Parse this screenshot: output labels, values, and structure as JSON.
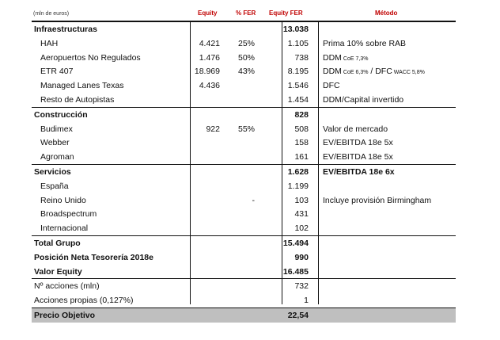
{
  "header": {
    "unit": "(mln de euros)",
    "equity": "Equity",
    "fer_pct": "% FER",
    "equity_fer": "Equity FER",
    "method": "Método"
  },
  "rows": [
    {
      "label": "Infraestructuras",
      "equity": "",
      "fer": "",
      "efer": "13.038",
      "method": "",
      "type": "section"
    },
    {
      "label": "HAH",
      "equity": "4.421",
      "fer": "25%",
      "efer": "1.105",
      "method": "Prima 10% sobre RAB",
      "type": "sub"
    },
    {
      "label": "Aeropuertos No Regulados",
      "equity": "1.476",
      "fer": "50%",
      "efer": "738",
      "method": "DDM",
      "method_small": "CoE 7,3%",
      "type": "sub"
    },
    {
      "label": "ETR 407",
      "equity": "18.969",
      "fer": "43%",
      "efer": "8.195",
      "method": "DDM",
      "method_small": "CoE 6,3%",
      "method2": " / DFC",
      "method_small2": "WACC 5,8%",
      "type": "sub"
    },
    {
      "label": "Managed Lanes Texas",
      "equity": "4.436",
      "fer": "",
      "efer": "1.546",
      "method": "DFC",
      "type": "sub"
    },
    {
      "label": "Resto de Autopistas",
      "equity": "",
      "fer": "",
      "efer": "1.454",
      "method": "DDM/Capital invertido",
      "type": "sub"
    },
    {
      "label": "Construcción",
      "equity": "",
      "fer": "",
      "efer": "828",
      "method": "",
      "type": "section"
    },
    {
      "label": "Budimex",
      "equity": "922",
      "fer": "55%",
      "efer": "508",
      "method": "Valor de mercado",
      "type": "sub"
    },
    {
      "label": "Webber",
      "equity": "",
      "fer": "",
      "efer": "158",
      "method": "EV/EBITDA 18e 5x",
      "type": "sub"
    },
    {
      "label": "Agroman",
      "equity": "",
      "fer": "",
      "efer": "161",
      "method": "EV/EBITDA 18e 5x",
      "type": "sub"
    },
    {
      "label": "Servicios",
      "equity": "",
      "fer": "",
      "efer": "1.628",
      "method": "EV/EBITDA 18e 6x",
      "type": "section"
    },
    {
      "label": "España",
      "equity": "",
      "fer": "",
      "efer": "1.199",
      "method": "",
      "type": "sub"
    },
    {
      "label": "Reino Unido",
      "equity": "",
      "fer": "-",
      "efer": "103",
      "method": "Incluye provisión Birmingham",
      "type": "sub"
    },
    {
      "label": "Broadspectrum",
      "equity": "",
      "fer": "",
      "efer": "431",
      "method": "",
      "type": "sub"
    },
    {
      "label": "Internacional",
      "equity": "",
      "fer": "",
      "efer": "102",
      "method": "",
      "type": "sub"
    },
    {
      "label": "Total Grupo",
      "equity": "",
      "fer": "",
      "efer": "15.494",
      "method": "",
      "type": "total"
    },
    {
      "label": "Posición Neta Tesorería 2018e",
      "equity": "",
      "fer": "",
      "efer": "990",
      "method": "",
      "type": "total2"
    },
    {
      "label": "Valor Equity",
      "equity": "",
      "fer": "",
      "efer": "16.485",
      "method": "",
      "type": "total2"
    },
    {
      "label": "Nº acciones (mln)",
      "equity": "",
      "fer": "",
      "efer": "732",
      "method": "",
      "type": "plain-top"
    },
    {
      "label": "Acciones propias (0,127%)",
      "equity": "",
      "fer": "",
      "efer": "1",
      "method": "",
      "type": "plain"
    },
    {
      "label": "Precio Objetivo",
      "equity": "",
      "fer": "",
      "efer": "22,54",
      "method": "",
      "type": "final"
    }
  ]
}
